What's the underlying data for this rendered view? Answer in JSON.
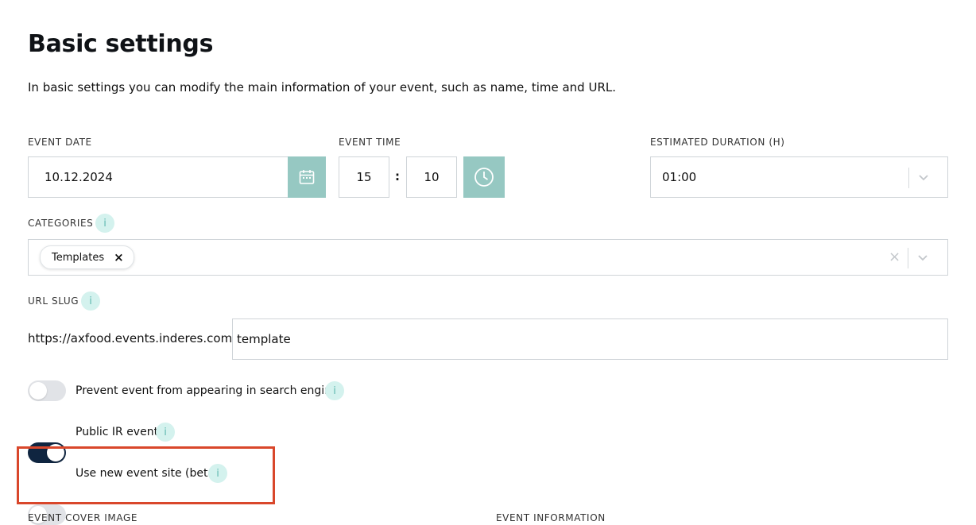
{
  "page": {
    "title": "Basic settings",
    "description": "In basic settings you can modify the main information of your event, such as name, time and URL."
  },
  "event_date": {
    "label": "EVENT DATE",
    "value": "10.12.2024",
    "icon": "calendar-icon"
  },
  "event_time": {
    "label": "EVENT TIME",
    "hour": "15",
    "separator": ":",
    "minute": "10",
    "icon": "clock-icon"
  },
  "duration": {
    "label": "ESTIMATED DURATION (H)",
    "value": "01:00",
    "icon": "chevron-down-icon"
  },
  "categories": {
    "label": "CATEGORIES",
    "info": "i",
    "chips": [
      {
        "label": "Templates",
        "remove": "×"
      }
    ],
    "clear": "×"
  },
  "url_slug": {
    "label": "URL SLUG",
    "info": "i",
    "prefix": "https://axfood.events.inderes.com/",
    "value": "template"
  },
  "toggles": [
    {
      "label": "Prevent event from appearing in search engines",
      "on": false,
      "info": "i"
    },
    {
      "label": "Public IR event",
      "on": true,
      "info": "i"
    },
    {
      "label": "Use new event site (beta)",
      "on": false,
      "info": "i"
    }
  ],
  "bottom_labels": {
    "cover_image": "EVENT COVER IMAGE",
    "event_information": "EVENT INFORMATION"
  },
  "colors": {
    "accent_teal": "#96c8c2",
    "toggle_on": "#0f2540",
    "highlight": "#d9472b"
  }
}
